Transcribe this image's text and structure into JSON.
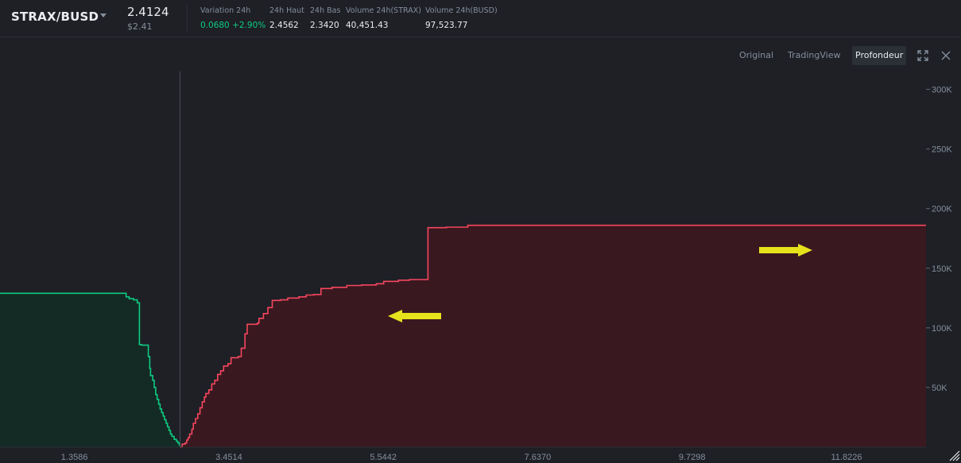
{
  "header": {
    "pair": "STRAX/BUSD",
    "price": "2.4124",
    "price_usd": "$2.41",
    "stats": [
      {
        "label": "Variation 24h",
        "value": "0.0680 +2.90%",
        "color": "#0ecb81"
      },
      {
        "label": "24h Haut",
        "value": "2.4562"
      },
      {
        "label": "24h Bas",
        "value": "2.3420"
      },
      {
        "label": "Volume 24h(STRAX)",
        "value": "40,451.43"
      },
      {
        "label": "Volume 24h(BUSD)",
        "value": "97,523.77"
      }
    ]
  },
  "toolbar": {
    "views": [
      "Original",
      "TradingView",
      "Profondeur"
    ],
    "active_view": "Profondeur",
    "icons": [
      "fullscreen-icon",
      "close-icon"
    ]
  },
  "colors": {
    "bid": "#0ecb81",
    "bid_fill": "#132b24",
    "ask": "#f6465d",
    "ask_fill": "#3a1820",
    "annotation": "#e6e21c"
  },
  "chart_data": {
    "type": "area",
    "xlim": [
      0.35,
      12.9
    ],
    "ylim": [
      0,
      315000
    ],
    "x_ticks": [
      "1.3586",
      "3.4514",
      "5.5442",
      "7.6370",
      "9.7298",
      "11.8226"
    ],
    "x_tick_values": [
      1.3586,
      3.4514,
      5.5442,
      7.637,
      9.7298,
      11.8226
    ],
    "y_ticks": [
      "50K",
      "100K",
      "150K",
      "200K",
      "250K",
      "300K"
    ],
    "y_tick_values": [
      50000,
      100000,
      150000,
      200000,
      250000,
      300000
    ],
    "mid_price": 2.4124,
    "series": [
      {
        "side": "bid",
        "points": [
          [
            0.35,
            129000
          ],
          [
            0.5,
            129000
          ],
          [
            1.0,
            129000
          ],
          [
            1.5,
            129000
          ],
          [
            2.0,
            129000
          ],
          [
            2.04,
            129000
          ],
          [
            2.06,
            126000
          ],
          [
            2.1,
            124500
          ],
          [
            2.16,
            123500
          ],
          [
            2.21,
            121000
          ],
          [
            2.24,
            86000
          ],
          [
            2.27,
            85500
          ],
          [
            2.32,
            85500
          ],
          [
            2.36,
            76000
          ],
          [
            2.38,
            66000
          ],
          [
            2.39,
            60000
          ],
          [
            2.42,
            56000
          ],
          [
            2.44,
            50000
          ],
          [
            2.46,
            44000
          ],
          [
            2.48,
            40000
          ],
          [
            2.5,
            36000
          ],
          [
            2.52,
            32000
          ],
          [
            2.54,
            29000
          ],
          [
            2.56,
            26000
          ],
          [
            2.58,
            23000
          ],
          [
            2.6,
            20000
          ],
          [
            2.62,
            17000
          ],
          [
            2.64,
            14000
          ],
          [
            2.66,
            11000
          ],
          [
            2.68,
            9000
          ],
          [
            2.71,
            6500
          ],
          [
            2.74,
            5000
          ],
          [
            2.76,
            3500
          ],
          [
            2.78,
            2000
          ],
          [
            2.79,
            0
          ]
        ]
      },
      {
        "side": "ask",
        "points": [
          [
            2.79,
            0
          ],
          [
            2.82,
            2500
          ],
          [
            2.86,
            3500
          ],
          [
            2.88,
            6000
          ],
          [
            2.9,
            8000
          ],
          [
            2.92,
            11000
          ],
          [
            2.95,
            15000
          ],
          [
            2.97,
            20000
          ],
          [
            3.0,
            24000
          ],
          [
            3.03,
            28000
          ],
          [
            3.06,
            33000
          ],
          [
            3.09,
            38000
          ],
          [
            3.12,
            42000
          ],
          [
            3.14,
            45000
          ],
          [
            3.18,
            48000
          ],
          [
            3.22,
            53000
          ],
          [
            3.26,
            56000
          ],
          [
            3.3,
            61000
          ],
          [
            3.34,
            64000
          ],
          [
            3.38,
            68000
          ],
          [
            3.44,
            70000
          ],
          [
            3.48,
            75000
          ],
          [
            3.58,
            76000
          ],
          [
            3.62,
            83000
          ],
          [
            3.67,
            95000
          ],
          [
            3.7,
            103000
          ],
          [
            3.84,
            104000
          ],
          [
            3.86,
            108000
          ],
          [
            3.92,
            112000
          ],
          [
            3.98,
            117000
          ],
          [
            4.04,
            123000
          ],
          [
            4.15,
            123500
          ],
          [
            4.25,
            125000
          ],
          [
            4.4,
            126000
          ],
          [
            4.5,
            127500
          ],
          [
            4.6,
            128000
          ],
          [
            4.7,
            133000
          ],
          [
            4.85,
            134000
          ],
          [
            5.05,
            135500
          ],
          [
            5.25,
            136000
          ],
          [
            5.45,
            137000
          ],
          [
            5.55,
            139000
          ],
          [
            5.75,
            140000
          ],
          [
            5.9,
            140500
          ],
          [
            6.15,
            184000
          ],
          [
            6.4,
            184500
          ],
          [
            6.67,
            184500
          ],
          [
            6.69,
            186000
          ],
          [
            7.0,
            186000
          ],
          [
            8.0,
            186000
          ],
          [
            12.9,
            186000
          ]
        ]
      }
    ]
  }
}
